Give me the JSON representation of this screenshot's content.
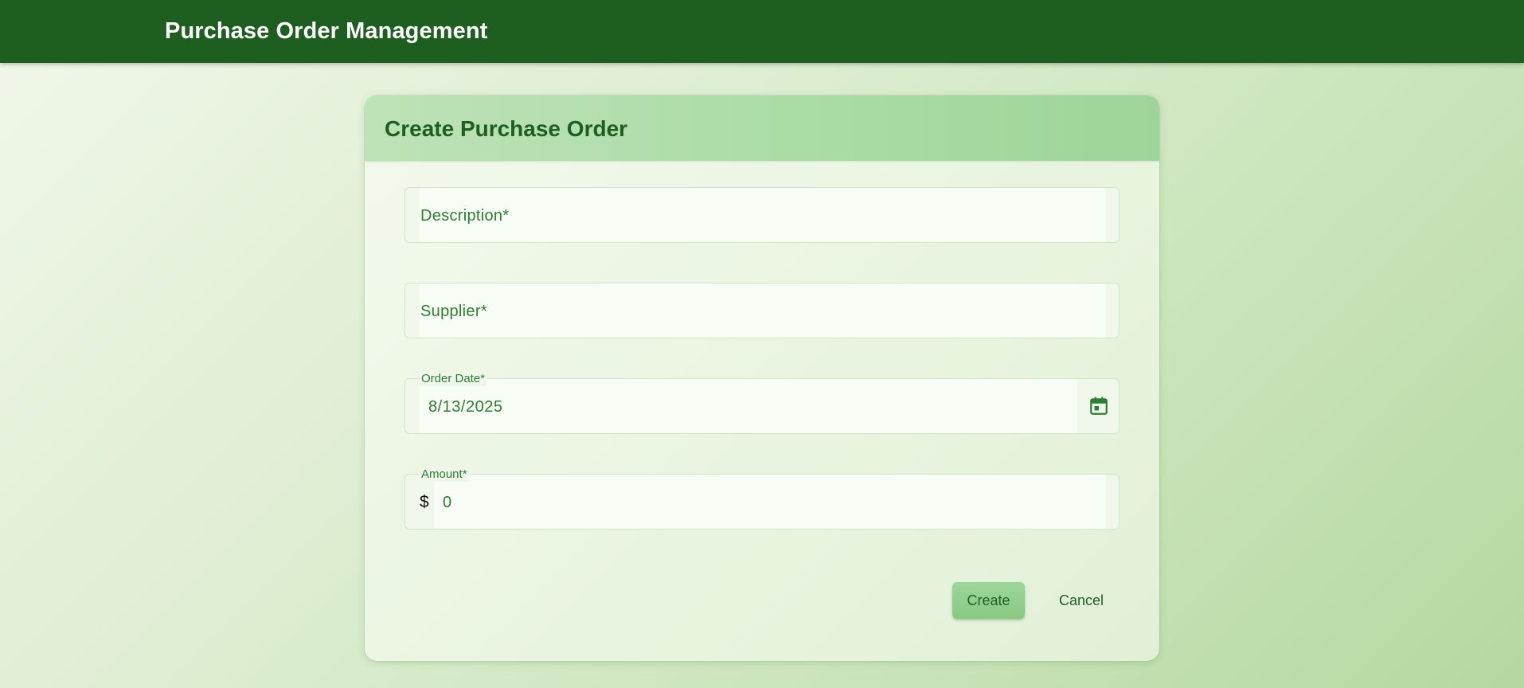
{
  "app_bar": {
    "title": "Purchase Order Management",
    "background_color": "#1e5e20"
  },
  "form": {
    "title": "Create Purchase Order",
    "fields": {
      "description": {
        "label": "Description*",
        "value": ""
      },
      "supplier": {
        "label": "Supplier*",
        "value": ""
      },
      "order_date": {
        "label": "Order Date*",
        "value": "8/13/2025",
        "icon": "calendar-icon"
      },
      "amount": {
        "label": "Amount*",
        "prefix": "$",
        "value": "0"
      }
    },
    "actions": {
      "create_label": "Create",
      "cancel_label": "Cancel"
    }
  },
  "colors": {
    "accent": "#2e7d32",
    "primary_dark": "#1e5e20",
    "button_fill": "#9dd59a"
  }
}
